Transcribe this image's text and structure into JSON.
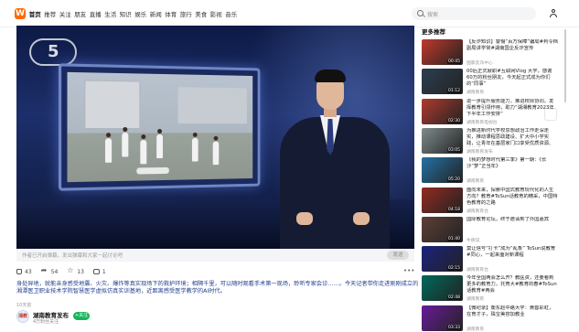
{
  "nav": {
    "logo": "W",
    "items": [
      "首页",
      "推荐",
      "关注",
      "朋友",
      "直播",
      "生活",
      "知识",
      "娱乐",
      "新闻",
      "体育",
      "旅行",
      "美食",
      "影视",
      "音乐"
    ],
    "active_index": 0
  },
  "search": {
    "placeholder": "搜索"
  },
  "player": {
    "channel_logo": "5"
  },
  "danmu": {
    "placeholder": "作者已开启弹幕，发出弹幕和大家一起讨论吧",
    "send": "发送"
  },
  "actions": {
    "likes": "43",
    "shares": "54",
    "favorites": "13",
    "comments": "1"
  },
  "video": {
    "description": "身处异地，就能亲身感受地震、火灾、爆炸等真实现场下的救护环境；相隔千里，可以随时观看手术第一现场，聆听专家会诊……。今天记者带你走进刚刚成立的湘潭医卫职业技术学院智慧医学虚拟仿真实训基地，近距离感受医学教学的AI时代。",
    "time": "10天前"
  },
  "author": {
    "avatar": "湘教",
    "name": "湖南教育发布",
    "fans": "4万粉丝关注",
    "follow": "+关注"
  },
  "sidebar": {
    "title": "更多推荐",
    "items": [
      {
        "title": "【反诈知识】警惕“百万保障”骗局#判令档副局讲学常#湖南国企反诈宣传",
        "source": "国家反诈中心",
        "duration": "00:45",
        "color": "#c0392b"
      },
      {
        "title": "00后正式就职#互联网Vlog 大学，感谢60万的粉丝朋友，今天起正式成为你们的“同事”",
        "source": "湖南教育",
        "duration": "01:12",
        "color": "#2c3e50"
      },
      {
        "title": "进一步提升服务能力，推进校际协同，发挥教育引领作用，助力“湖湘教育2023年下半年工作安排”",
        "source": "湖南教育电视台",
        "duration": "02:30",
        "color": "#b03a2e"
      },
      {
        "title": "为推进新时代学校思想政治工作走深走实，推动课程思政建设、扩大中小学实践，让青年在基层家门口享受优质资源、追梦成才",
        "source": "湖南教育发布",
        "duration": "03:05",
        "color": "#7f8c8d"
      },
      {
        "title": "《我的梦想时代第三季》第一期：《长沙“梦”正当年》",
        "source": "湖南教育",
        "duration": "05:20",
        "color": "#2471a3"
      },
      {
        "title": "面向未来，探索中国式教育现代化的人生方向？教育#ToSun话教育的精采，中国特色教育的之路",
        "source": "湖南教育台",
        "duration": "04:18",
        "color": "#922b21"
      },
      {
        "title": "国际教育论坛，终于邀请到了外国嘉宾",
        "source": "牛牌说",
        "duration": "01:40",
        "color": "#5d4037"
      },
      {
        "title": "莫让信号“打卡”成为“乱象” ToSun说教育#同心，一起来面对新课程",
        "source": "湖南教育台",
        "duration": "02:15",
        "color": "#1a237e"
      },
      {
        "title": "今年全国两会怎么开？教医资，还要看到更多的教育力，托育大#教育的春#ToSun话教育#两会",
        "source": "湖南教育",
        "duration": "02:48",
        "color": "#00695c"
      },
      {
        "title": "【微纪录】衡东赵中路大学：黄蓉彩虹，在育才子，珠宝美容加教业",
        "source": "湖南教育",
        "duration": "03:33",
        "color": "#6a1b9a"
      }
    ]
  }
}
